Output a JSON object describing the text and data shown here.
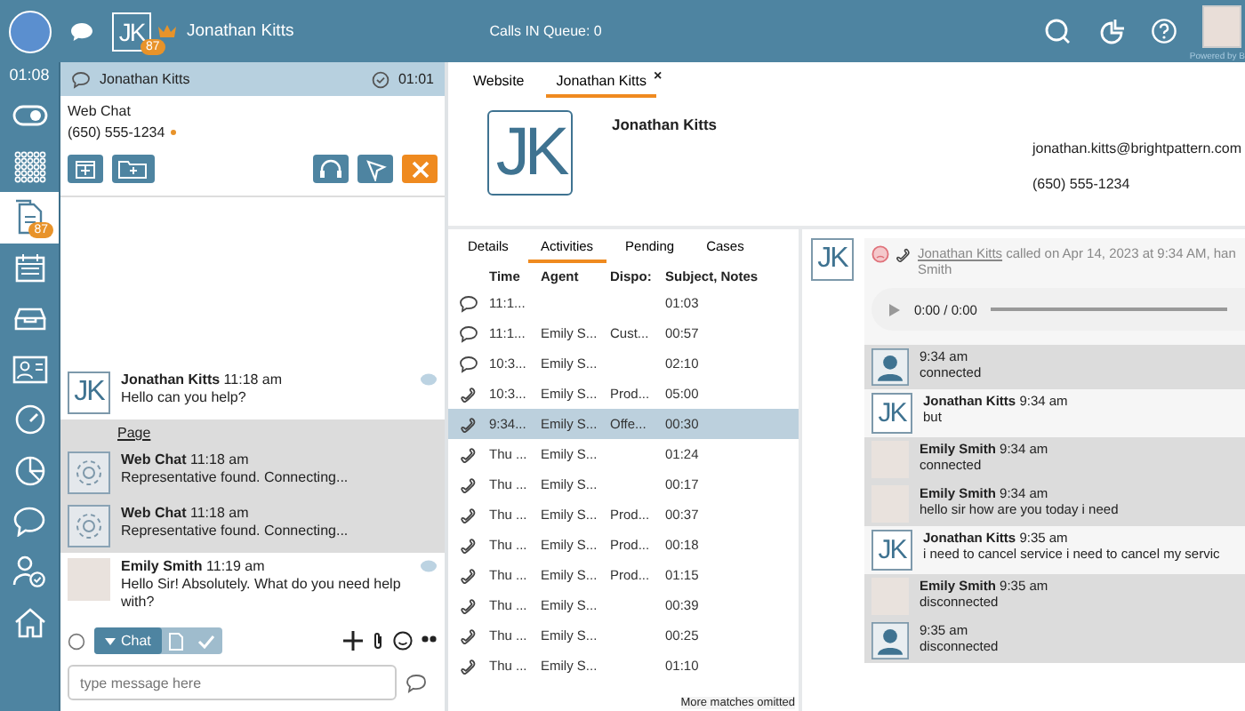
{
  "top_bar": {
    "timer": "01:08",
    "contact_initials": "JK",
    "contact_badge": "87",
    "contact_name": "Jonathan Kitts",
    "queue": "Calls IN Queue: 0",
    "powered": "Powered by B"
  },
  "rail": [
    {
      "kind": "toggle",
      "selected": false
    },
    {
      "kind": "dialpad",
      "selected": false
    },
    {
      "kind": "documents",
      "selected": true,
      "badge": "87"
    },
    {
      "kind": "calendar",
      "selected": false
    },
    {
      "kind": "tray",
      "selected": false
    },
    {
      "kind": "contacts",
      "selected": false
    },
    {
      "kind": "gauge",
      "selected": false
    },
    {
      "kind": "pie",
      "selected": false
    },
    {
      "kind": "chat",
      "selected": false
    },
    {
      "kind": "user-check",
      "selected": false
    },
    {
      "kind": "home",
      "selected": false
    }
  ],
  "chat_panel": {
    "name": "Jonathan Kitts",
    "timer": "01:01",
    "channel": "Web Chat",
    "phone": "(650) 555-1234",
    "messages": [
      {
        "kind": "customer",
        "author": "Jonathan Kitts",
        "time": "11:18 am",
        "text": "Hello can you help?",
        "initials": "JK"
      },
      {
        "kind": "page",
        "text": "Page"
      },
      {
        "kind": "system",
        "author": "Web Chat",
        "time": "11:18 am",
        "text": "Representative found. Connecting..."
      },
      {
        "kind": "system",
        "author": "Web Chat",
        "time": "11:18 am",
        "text": "Representative found. Connecting..."
      },
      {
        "kind": "agent",
        "author": "Emily Smith",
        "time": "11:19 am",
        "text": "Hello Sir!  Absolutely.  What do you need help with?"
      }
    ],
    "composer_tab": "Chat",
    "placeholder": "type message here"
  },
  "contact_tabs": [
    {
      "label": "Website",
      "selected": false
    },
    {
      "label": "Jonathan Kitts",
      "selected": true,
      "close": "×"
    }
  ],
  "contact": {
    "initials": "JK",
    "name": "Jonathan Kitts",
    "email": "jonathan.kitts@brightpattern.com",
    "phone": "(650) 555-1234"
  },
  "sub_tabs": [
    {
      "label": "Details",
      "selected": false
    },
    {
      "label": "Activities",
      "selected": true
    },
    {
      "label": "Pending",
      "selected": false
    },
    {
      "label": "Cases",
      "selected": false
    }
  ],
  "activities": {
    "columns": [
      "Time",
      "Agent",
      "Dispo:",
      "Subject, Notes"
    ],
    "rows": [
      {
        "kind": "chat",
        "time": "11:1...",
        "agent": "",
        "dispo": "",
        "duration": "01:03",
        "selected": false
      },
      {
        "kind": "chat",
        "time": "11:1...",
        "agent": "Emily S...",
        "dispo": "Cust...",
        "duration": "00:57",
        "selected": false
      },
      {
        "kind": "chat",
        "time": "10:3...",
        "agent": "Emily S...",
        "dispo": "",
        "duration": "02:10",
        "selected": false
      },
      {
        "kind": "call",
        "time": "10:3...",
        "agent": "Emily S...",
        "dispo": "Prod...",
        "duration": "05:00",
        "selected": false
      },
      {
        "kind": "call",
        "time": "9:34...",
        "agent": "Emily S...",
        "dispo": "Offe...",
        "duration": "00:30",
        "selected": true
      },
      {
        "kind": "call",
        "time": "Thu ...",
        "agent": "Emily S...",
        "dispo": "",
        "duration": "01:24",
        "selected": false
      },
      {
        "kind": "call",
        "time": "Thu ...",
        "agent": "Emily S...",
        "dispo": "",
        "duration": "00:17",
        "selected": false
      },
      {
        "kind": "call",
        "time": "Thu ...",
        "agent": "Emily S...",
        "dispo": "Prod...",
        "duration": "00:37",
        "selected": false
      },
      {
        "kind": "call",
        "time": "Thu ...",
        "agent": "Emily S...",
        "dispo": "Prod...",
        "duration": "00:18",
        "selected": false
      },
      {
        "kind": "call",
        "time": "Thu ...",
        "agent": "Emily S...",
        "dispo": "Prod...",
        "duration": "01:15",
        "selected": false
      },
      {
        "kind": "call",
        "time": "Thu ...",
        "agent": "Emily S...",
        "dispo": "",
        "duration": "00:39",
        "selected": false
      },
      {
        "kind": "call",
        "time": "Thu ...",
        "agent": "Emily S...",
        "dispo": "",
        "duration": "00:25",
        "selected": false
      },
      {
        "kind": "call",
        "time": "Thu ...",
        "agent": "Emily S...",
        "dispo": "",
        "duration": "01:10",
        "selected": false
      }
    ],
    "footer": "More matches omitted"
  },
  "detail": {
    "initials": "JK",
    "summary_link": "Jonathan Kitts",
    "summary_text": "called on Apr 14, 2023 at 9:34 AM, han",
    "summary_more": "Smith",
    "audio_time": "0:00 / 0:00",
    "transcript": [
      {
        "kind": "system",
        "time": "9:34 am",
        "text": "connected"
      },
      {
        "kind": "customer",
        "author": "Jonathan Kitts",
        "initials": "JK",
        "time": "9:34 am",
        "text": "but"
      },
      {
        "kind": "agent",
        "author": "Emily Smith",
        "time": "9:34 am",
        "text": "connected"
      },
      {
        "kind": "agent",
        "author": "Emily Smith",
        "time": "9:34 am",
        "text": "hello sir how are you today i need"
      },
      {
        "kind": "customer",
        "author": "Jonathan Kitts",
        "initials": "JK",
        "time": "9:35 am",
        "text": "i need to cancel service i need to cancel my servic"
      },
      {
        "kind": "agent",
        "author": "Emily Smith",
        "time": "9:35 am",
        "text": "disconnected"
      },
      {
        "kind": "system",
        "time": "9:35 am",
        "text": "disconnected"
      }
    ]
  }
}
